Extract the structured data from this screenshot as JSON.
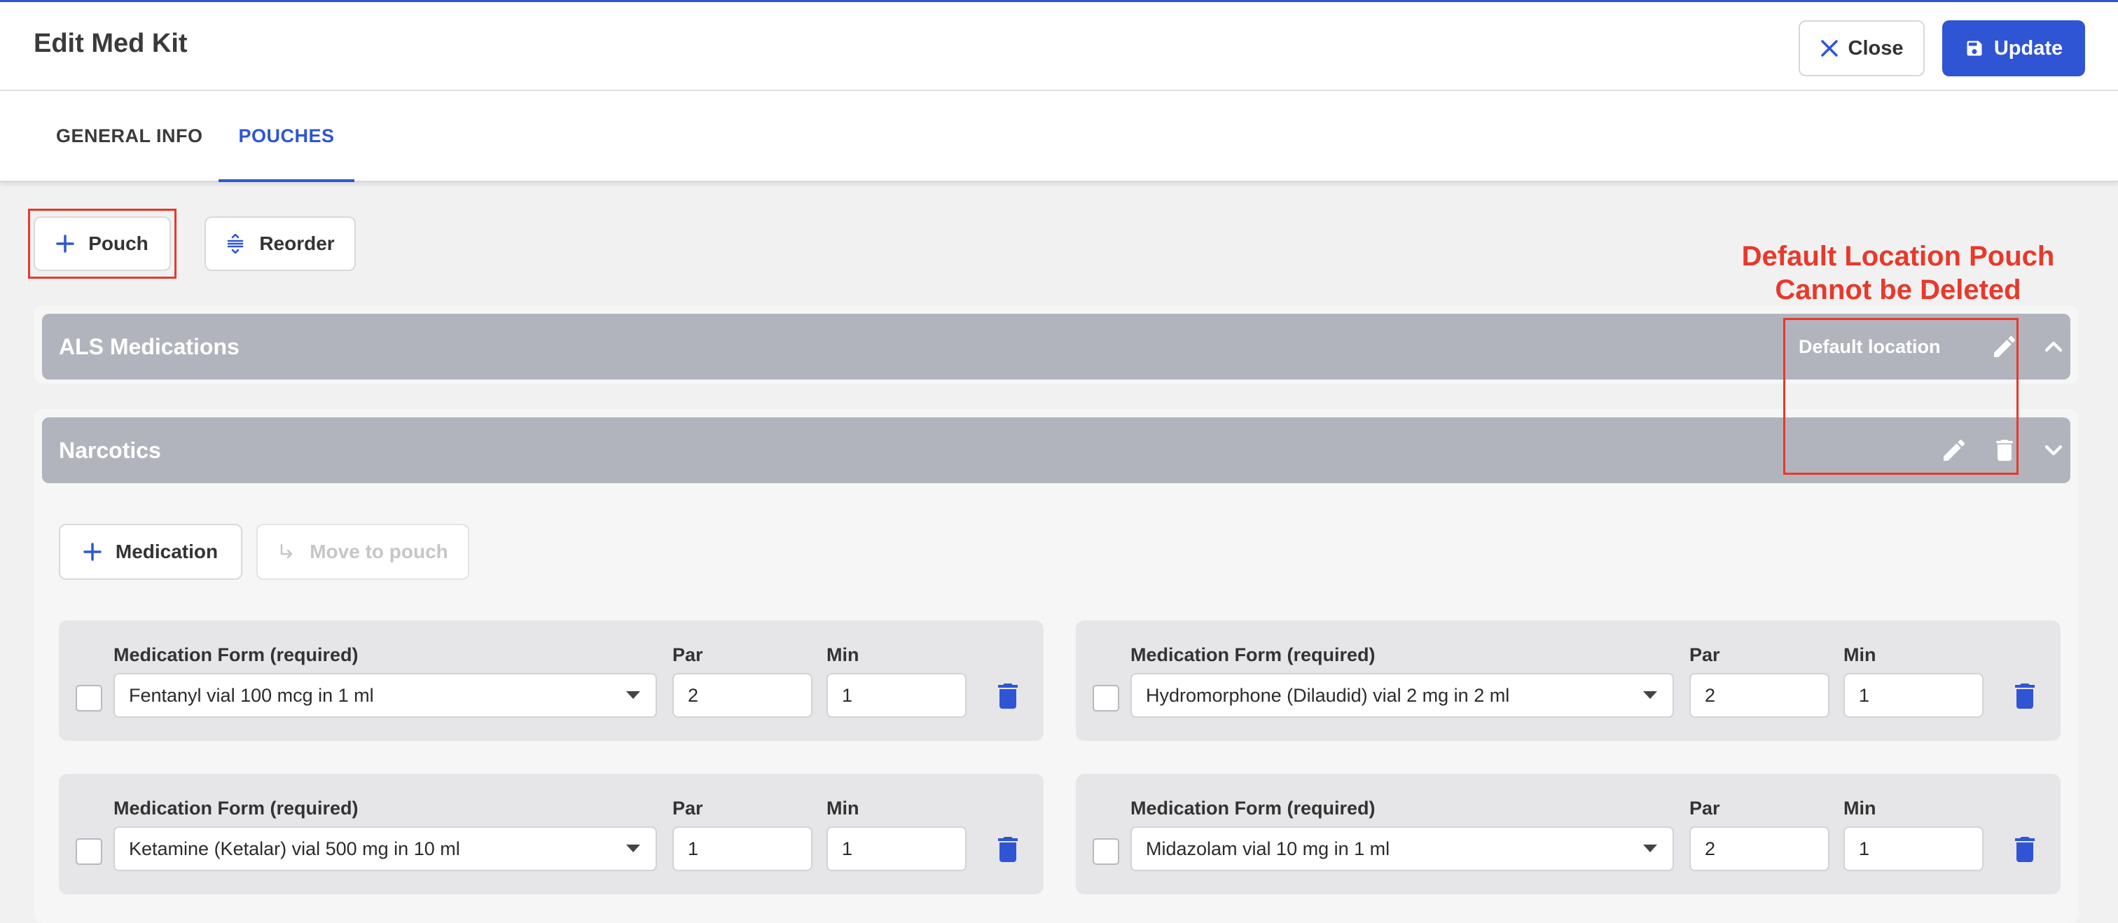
{
  "header": {
    "title": "Edit Med Kit",
    "close_label": "Close",
    "update_label": "Update",
    "close_icon": "close-icon",
    "update_icon": "save-icon"
  },
  "tabs": [
    {
      "label": "GENERAL INFO",
      "active": false
    },
    {
      "label": "POUCHES",
      "active": true
    }
  ],
  "toolbar": {
    "add_pouch_label": "Pouch",
    "reorder_label": "Reorder"
  },
  "annotation": {
    "line1": "Default Location Pouch",
    "line2": "Cannot be Deleted"
  },
  "pouches": [
    {
      "name": "ALS Medications",
      "default_label": "Default location",
      "expanded": false
    },
    {
      "name": "Narcotics",
      "expanded": true,
      "add_medication_label": "Medication",
      "move_to_pouch_label": "Move to pouch",
      "medications": [
        {
          "form_label": "Medication Form (required)",
          "form": "Fentanyl vial 100 mcg in 1 ml",
          "par_label": "Par",
          "par": "2",
          "min_label": "Min",
          "min": "1"
        },
        {
          "form_label": "Medication Form (required)",
          "form": "Hydromorphone (Dilaudid) vial 2 mg in 2 ml",
          "par_label": "Par",
          "par": "2",
          "min_label": "Min",
          "min": "1"
        },
        {
          "form_label": "Medication Form (required)",
          "form": "Ketamine (Ketalar) vial 500 mg in 10 ml",
          "par_label": "Par",
          "par": "1",
          "min_label": "Min",
          "min": "1"
        },
        {
          "form_label": "Medication Form (required)",
          "form": "Midazolam vial 10 mg in 1 ml",
          "par_label": "Par",
          "par": "2",
          "min_label": "Min",
          "min": "1"
        }
      ]
    }
  ],
  "colors": {
    "primary": "#2f55d4",
    "annotation": "#e8392a",
    "pouch_header": "#b2b4bd"
  }
}
